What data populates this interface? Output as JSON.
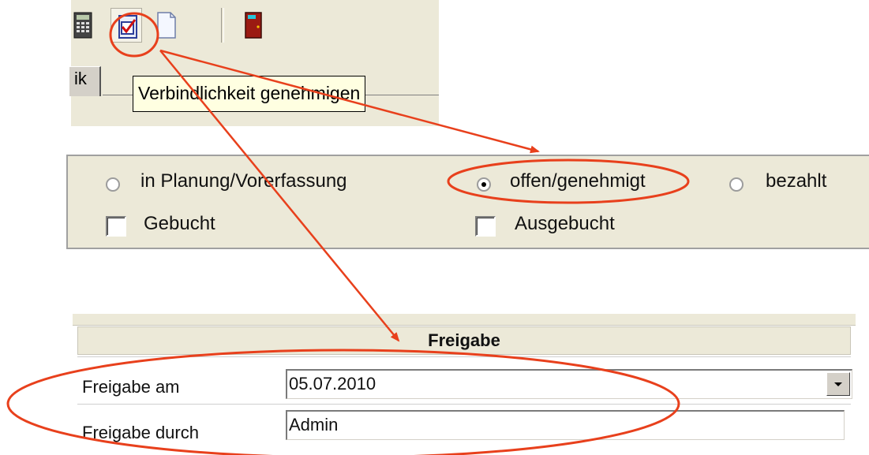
{
  "toolbar": {
    "buttons": [
      {
        "icon": "calculator-icon"
      },
      {
        "icon": "approve-document-icon"
      },
      {
        "icon": "blank-document-icon"
      },
      {
        "icon": "exit-door-icon"
      }
    ],
    "tab_label": "ik",
    "tooltip": "Verbindlichkeit genehmigen"
  },
  "status": {
    "radios": [
      {
        "label": "in Planung/Vorerfassung",
        "checked": false
      },
      {
        "label": "offen/genehmigt",
        "checked": true
      },
      {
        "label": "bezahlt",
        "checked": false
      }
    ],
    "checkboxes": [
      {
        "label": "Gebucht",
        "checked": false
      },
      {
        "label": "Ausgebucht",
        "checked": false
      }
    ]
  },
  "freigabe": {
    "header": "Freigabe",
    "rows": [
      {
        "label": "Freigabe am",
        "value": "05.07.2010"
      },
      {
        "label": "Freigabe durch",
        "value": "Admin"
      }
    ]
  },
  "colors": {
    "annotation_red": "#e8401c",
    "panel_bg": "#ece9d8",
    "tooltip_bg": "#ffffe1"
  }
}
